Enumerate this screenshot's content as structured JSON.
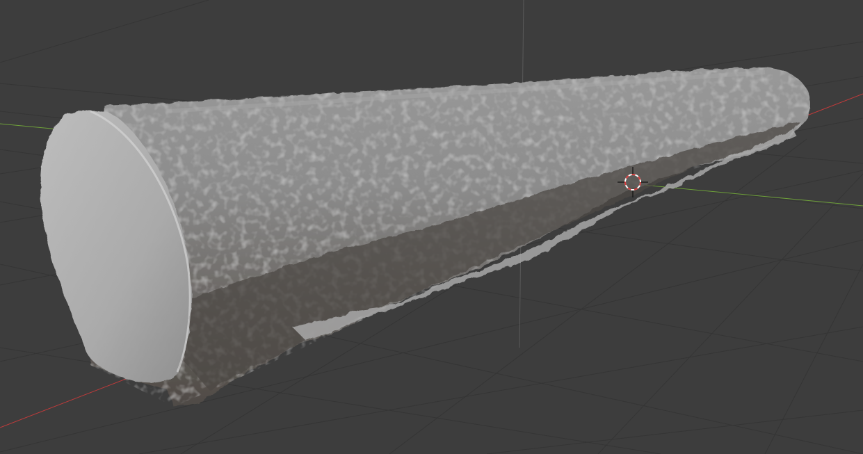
{
  "viewport": {
    "background": "#3d3d3d",
    "grid_color": "#353535",
    "x_axis_color": "#c23b3b",
    "y_axis_color": "#6fa23a",
    "z_axis_color": "#5a5a5a"
  },
  "mesh": {
    "object_type": "scanned log / cylinder",
    "shading": "solid",
    "base_color": "#8e8e8e",
    "cap_color": "#b3b3b3"
  },
  "cursor_3d": {
    "icon": "3d-cursor-icon",
    "ring_color_a": "#d63c3c",
    "ring_color_b": "#ffffff"
  }
}
